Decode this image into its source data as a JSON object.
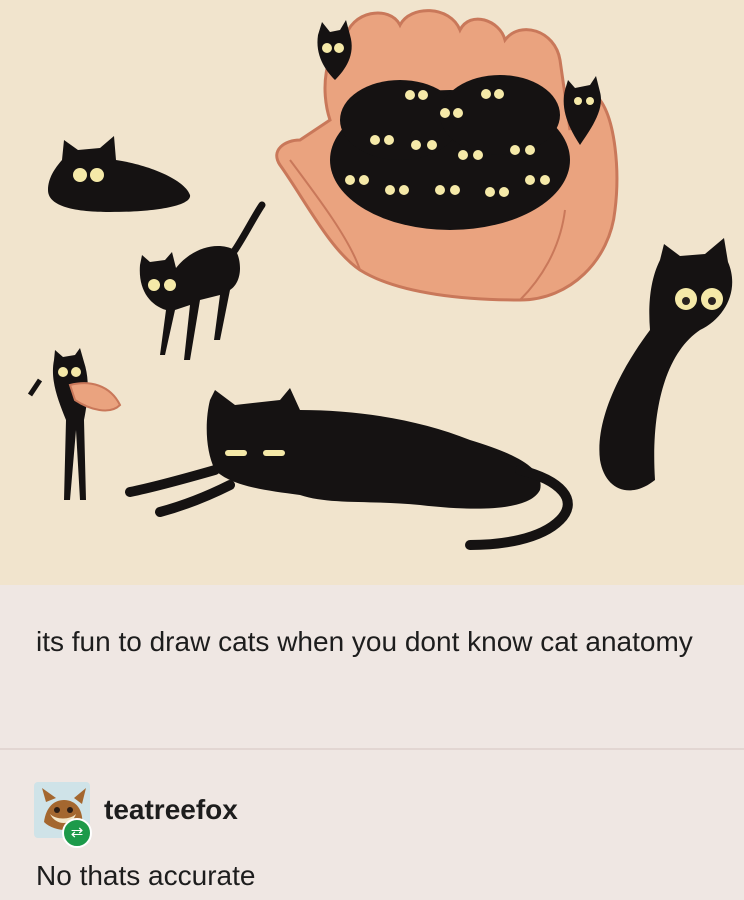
{
  "post": {
    "caption": "its fun to draw cats when you dont know cat anatomy"
  },
  "reblog": {
    "username": "teatreefox",
    "badge_icon": "reblog-icon",
    "text": "No thats accurate"
  },
  "colors": {
    "art_background": "#f1e4cd",
    "page_background": "#efe7e3",
    "cat_black": "#151212",
    "hand_skin": "#eaa37f",
    "reblog_green": "#1c9a4a"
  }
}
